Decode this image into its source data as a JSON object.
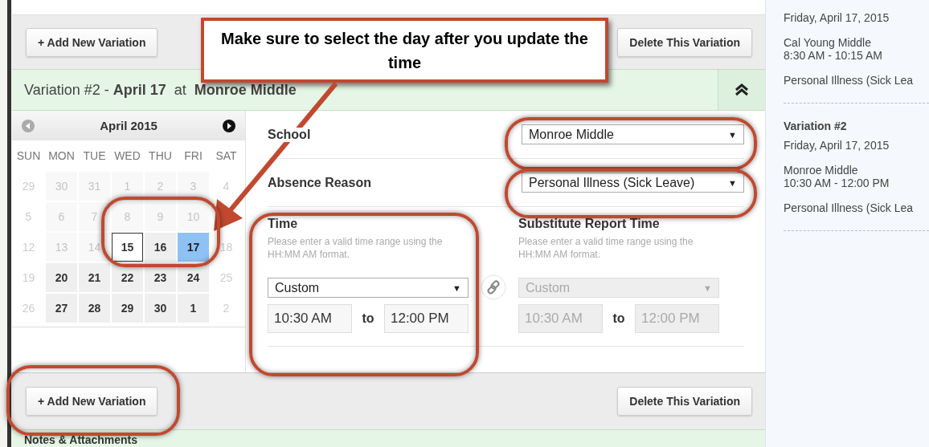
{
  "top_bar": {
    "add_button": "+ Add New Variation",
    "delete_button": "Delete This Variation"
  },
  "variation_header": {
    "text": "Variation #2 - **April 17**  at  **Monroe Middle**",
    "expanded": true
  },
  "calendar": {
    "month": "April 2015",
    "weekdays": [
      "SUN",
      "MON",
      "TUE",
      "WED",
      "THU",
      "FRI",
      "SAT"
    ],
    "weeks": [
      [
        {
          "label": "29",
          "kind": "weekend",
          "today": false,
          "selected": false
        },
        {
          "label": "30",
          "kind": "muted",
          "today": false,
          "selected": false
        },
        {
          "label": "31",
          "kind": "muted",
          "today": false,
          "selected": false
        },
        {
          "label": "1",
          "kind": "muted",
          "today": false,
          "selected": false
        },
        {
          "label": "2",
          "kind": "muted",
          "today": false,
          "selected": false
        },
        {
          "label": "3",
          "kind": "muted",
          "today": false,
          "selected": false
        },
        {
          "label": "4",
          "kind": "weekend",
          "today": false,
          "selected": false
        }
      ],
      [
        {
          "label": "5",
          "kind": "weekend",
          "today": false,
          "selected": false
        },
        {
          "label": "6",
          "kind": "muted",
          "today": false,
          "selected": false
        },
        {
          "label": "7",
          "kind": "muted",
          "today": false,
          "selected": false
        },
        {
          "label": "8",
          "kind": "muted",
          "today": false,
          "selected": false
        },
        {
          "label": "9",
          "kind": "muted",
          "today": false,
          "selected": false
        },
        {
          "label": "10",
          "kind": "muted",
          "today": false,
          "selected": false
        },
        {
          "kind": "weekend",
          "today": false,
          "selected": false
        }
      ],
      [
        {
          "label": "12",
          "kind": "weekend",
          "today": false,
          "selected": false
        },
        {
          "label": "13",
          "kind": "muted",
          "today": false,
          "selected": false
        },
        {
          "label": "14",
          "kind": "muted",
          "today": false,
          "selected": false
        },
        {
          "label": "15",
          "kind": "available",
          "today": true,
          "selected": false
        },
        {
          "label": "16",
          "kind": "available",
          "today": false,
          "selected": false
        },
        {
          "label": "17",
          "kind": "available",
          "today": false,
          "selected": true
        },
        {
          "label": "18",
          "kind": "weekend",
          "today": false,
          "selected": false
        }
      ],
      [
        {
          "label": "19",
          "kind": "weekend",
          "today": false,
          "selected": false
        },
        {
          "label": "20",
          "kind": "available",
          "today": false,
          "selected": false
        },
        {
          "label": "21",
          "kind": "available",
          "today": false,
          "selected": false
        },
        {
          "label": "22",
          "kind": "available",
          "today": false,
          "selected": false
        },
        {
          "label": "23",
          "kind": "available",
          "today": false,
          "selected": false
        },
        {
          "label": "24",
          "kind": "available",
          "today": false,
          "selected": false
        },
        {
          "label": "25",
          "kind": "weekend",
          "today": false,
          "selected": false
        }
      ],
      [
        {
          "label": "26",
          "kind": "weekend",
          "today": false,
          "selected": false
        },
        {
          "label": "27",
          "kind": "available",
          "today": false,
          "selected": false
        },
        {
          "label": "28",
          "kind": "available",
          "today": false,
          "selected": false
        },
        {
          "label": "29",
          "kind": "available",
          "today": false,
          "selected": false
        },
        {
          "label": "30",
          "kind": "available",
          "today": false,
          "selected": false
        },
        {
          "label": "1",
          "kind": "available",
          "today": false,
          "selected": false
        },
        {
          "label": "2",
          "kind": "weekend",
          "today": false,
          "selected": false
        }
      ]
    ]
  },
  "school": {
    "label": "School",
    "value": "Monroe Middle",
    "caret": "▼"
  },
  "absence_reason": {
    "label": "Absence Reason",
    "value": "Personal Illness (Sick Leave)",
    "caret": "▼"
  },
  "time_groups": [
    {
      "title": "Time",
      "hint": "Please enter a valid time range using the HH:MM AM format.",
      "preset": "Custom",
      "caret": "▼",
      "start": "10:30 AM",
      "separator": "to",
      "end": "12:00 PM",
      "disabled": false
    },
    {
      "title": "Substitute Report Time",
      "hint": "Please enter a valid time range using the HH:MM AM format.",
      "preset": "Custom",
      "caret": "▼",
      "start": "10:30 AM",
      "separator": "to",
      "end": "12:00 PM",
      "disabled": true
    }
  ],
  "bottom_bar": {
    "add_button": "+ Add New Variation",
    "delete_button": "Delete This Variation"
  },
  "notes_header": {
    "title": "Notes & Attachments"
  },
  "summary": [
    {
      "date": "Friday, April 17, 2015",
      "school": "Cal Young Middle",
      "hours": "8:30 AM - 10:15 AM",
      "reason": "Personal Illness (Sick Lea"
    },
    {
      "heading": "Variation #2",
      "date": "Friday, April 17, 2015",
      "school": "Monroe Middle",
      "hours": "10:30 AM - 12:00 PM",
      "reason": "Personal Illness (Sick Lea"
    }
  ],
  "callout": {
    "text": "Make sure to select the day after you update the time"
  }
}
